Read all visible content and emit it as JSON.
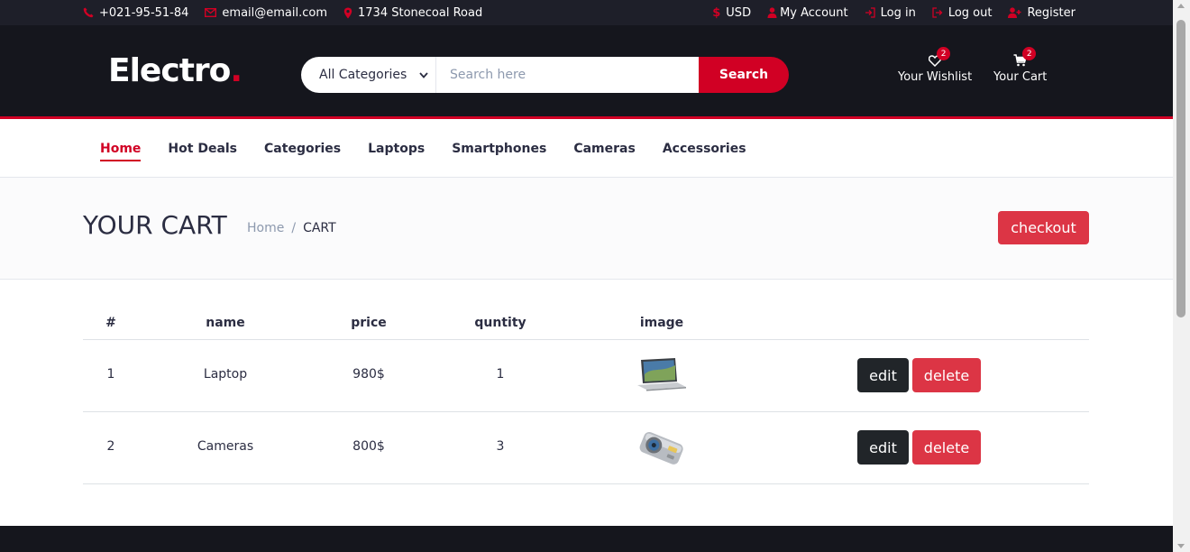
{
  "topbar": {
    "phone": "+021-95-51-84",
    "email": "email@email.com",
    "address": "1734 Stonecoal Road",
    "currency": "USD",
    "my_account": "My Account",
    "login": "Log in",
    "logout": "Log out",
    "register": "Register"
  },
  "header": {
    "logo_text": "Electro",
    "logo_dot": ".",
    "category_select": "All Categories",
    "search_placeholder": "Search here",
    "search_button": "Search",
    "wishlist_label": "Your Wishlist",
    "wishlist_count": "2",
    "cart_label": "Your Cart",
    "cart_count": "2"
  },
  "nav": {
    "items": [
      "Home",
      "Hot Deals",
      "Categories",
      "Laptops",
      "Smartphones",
      "Cameras",
      "Accessories"
    ],
    "active": "Home"
  },
  "breadcrumb": {
    "title": "YOUR CART",
    "home": "Home",
    "separator": "/",
    "current": "CART",
    "checkout_button": "checkout"
  },
  "table": {
    "headers": [
      "#",
      "name",
      "price",
      "quntity",
      "image"
    ],
    "rows": [
      {
        "index": "1",
        "name": "Laptop",
        "price": "980$",
        "quantity": "1",
        "image": "laptop",
        "edit": "edit",
        "delete": "delete"
      },
      {
        "index": "2",
        "name": "Cameras",
        "price": "800$",
        "quantity": "3",
        "image": "camera",
        "edit": "edit",
        "delete": "delete"
      }
    ]
  },
  "colors": {
    "accent": "#d10024",
    "dark": "#15161d",
    "danger": "#dc3545",
    "button_dark": "#212529"
  }
}
